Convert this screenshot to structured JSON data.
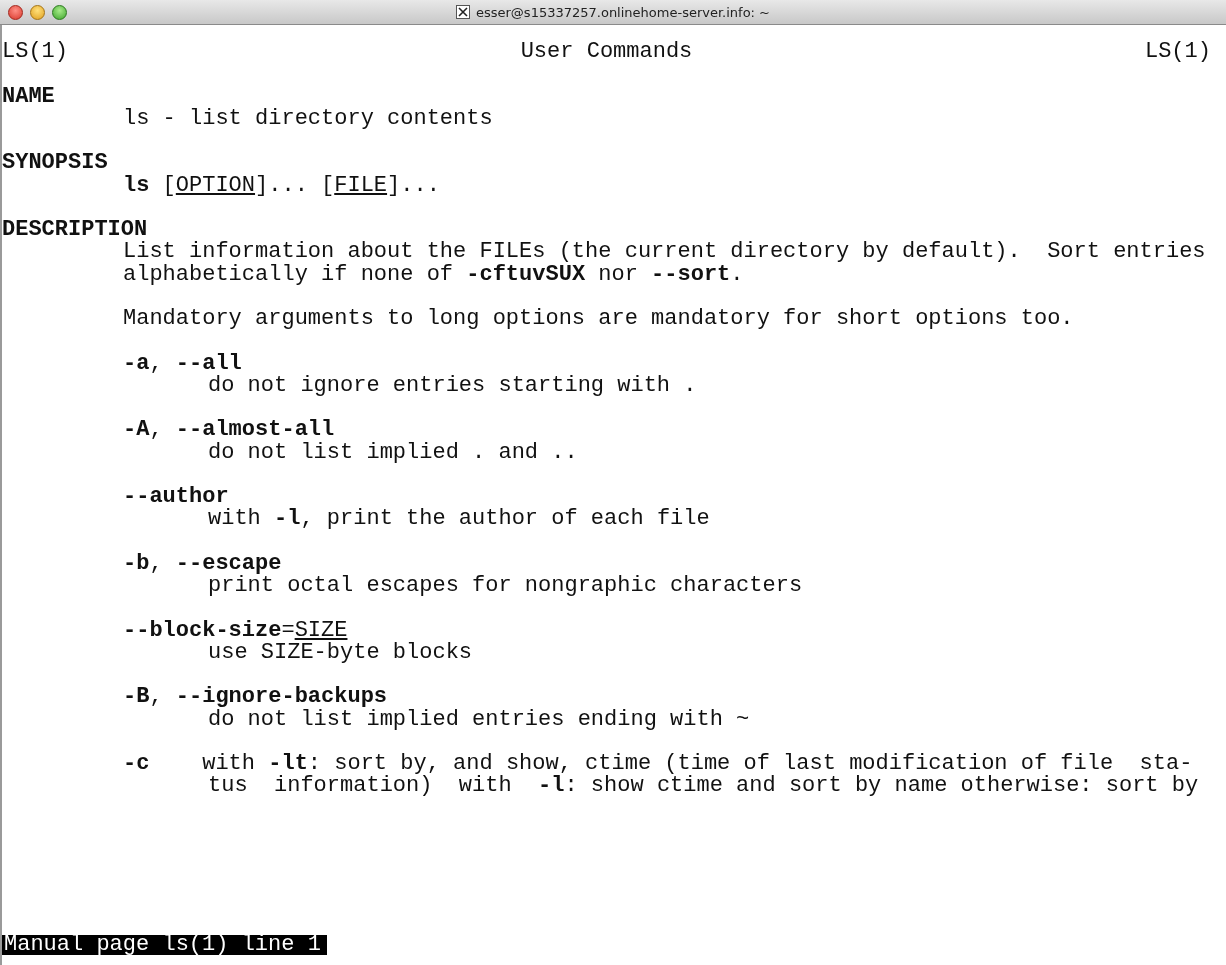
{
  "window": {
    "title": "esser@s15337257.onlinehome-server.info: ~"
  },
  "man_header": {
    "left": "LS(1)",
    "center": "User Commands",
    "right": "LS(1)"
  },
  "lines": [
    {
      "kind": "blank"
    },
    {
      "kind": "section",
      "parts": [
        {
          "text": "NAME"
        }
      ]
    },
    {
      "kind": "text",
      "parts": [
        {
          "text": "ls - list directory contents"
        }
      ]
    },
    {
      "kind": "blank"
    },
    {
      "kind": "section",
      "parts": [
        {
          "text": "SYNOPSIS"
        }
      ]
    },
    {
      "kind": "text",
      "parts": [
        {
          "text": "ls",
          "kind": "bold"
        },
        {
          "text": " ["
        },
        {
          "text": "OPTION",
          "kind": "underline"
        },
        {
          "text": "]... ["
        },
        {
          "text": "FILE",
          "kind": "underline"
        },
        {
          "text": "]..."
        }
      ]
    },
    {
      "kind": "blank"
    },
    {
      "kind": "section",
      "parts": [
        {
          "text": "DESCRIPTION"
        }
      ]
    },
    {
      "kind": "text",
      "parts": [
        {
          "text": "List information about the FILEs (the current directory by default).  Sort entries"
        }
      ]
    },
    {
      "kind": "text",
      "parts": [
        {
          "text": "alphabetically if none of "
        },
        {
          "text": "-cftuvSUX",
          "kind": "bold"
        },
        {
          "text": " nor "
        },
        {
          "text": "--sort",
          "kind": "bold"
        },
        {
          "text": "."
        }
      ]
    },
    {
      "kind": "blank"
    },
    {
      "kind": "text",
      "parts": [
        {
          "text": "Mandatory arguments to long options are mandatory for short options too."
        }
      ]
    },
    {
      "kind": "blank"
    },
    {
      "kind": "text",
      "parts": [
        {
          "text": "-a",
          "kind": "bold"
        },
        {
          "text": ", "
        },
        {
          "text": "--all",
          "kind": "bold"
        }
      ]
    },
    {
      "kind": "desc",
      "parts": [
        {
          "text": "do not ignore entries starting with ."
        }
      ]
    },
    {
      "kind": "blank"
    },
    {
      "kind": "text",
      "parts": [
        {
          "text": "-A",
          "kind": "bold"
        },
        {
          "text": ", "
        },
        {
          "text": "--almost-all",
          "kind": "bold"
        }
      ]
    },
    {
      "kind": "desc",
      "parts": [
        {
          "text": "do not list implied . and .."
        }
      ]
    },
    {
      "kind": "blank"
    },
    {
      "kind": "text",
      "parts": [
        {
          "text": "--author",
          "kind": "bold"
        }
      ]
    },
    {
      "kind": "desc",
      "parts": [
        {
          "text": "with "
        },
        {
          "text": "-l",
          "kind": "bold"
        },
        {
          "text": ", print the author of each file"
        }
      ]
    },
    {
      "kind": "blank"
    },
    {
      "kind": "text",
      "parts": [
        {
          "text": "-b",
          "kind": "bold"
        },
        {
          "text": ", "
        },
        {
          "text": "--escape",
          "kind": "bold"
        }
      ]
    },
    {
      "kind": "desc",
      "parts": [
        {
          "text": "print octal escapes for nongraphic characters"
        }
      ]
    },
    {
      "kind": "blank"
    },
    {
      "kind": "text",
      "parts": [
        {
          "text": "--block-size",
          "kind": "bold"
        },
        {
          "text": "="
        },
        {
          "text": "SIZE",
          "kind": "underline"
        }
      ]
    },
    {
      "kind": "desc",
      "parts": [
        {
          "text": "use SIZE-byte blocks"
        }
      ]
    },
    {
      "kind": "blank"
    },
    {
      "kind": "text",
      "parts": [
        {
          "text": "-B",
          "kind": "bold"
        },
        {
          "text": ", "
        },
        {
          "text": "--ignore-backups",
          "kind": "bold"
        }
      ]
    },
    {
      "kind": "desc",
      "parts": [
        {
          "text": "do not list implied entries ending with ~"
        }
      ]
    },
    {
      "kind": "blank"
    },
    {
      "kind": "text",
      "parts": [
        {
          "text": "-c",
          "kind": "bold"
        },
        {
          "text": "    with "
        },
        {
          "text": "-lt",
          "kind": "bold"
        },
        {
          "text": ": sort by, and show, ctime (time of last modification of file  sta-"
        }
      ]
    },
    {
      "kind": "desc",
      "parts": [
        {
          "text": "tus  information)  with  "
        },
        {
          "text": "-l",
          "kind": "bold"
        },
        {
          "text": ": show ctime and sort by name otherwise: sort by"
        }
      ]
    }
  ],
  "status_bar": {
    "text": "Manual page ls(1) line 1"
  }
}
